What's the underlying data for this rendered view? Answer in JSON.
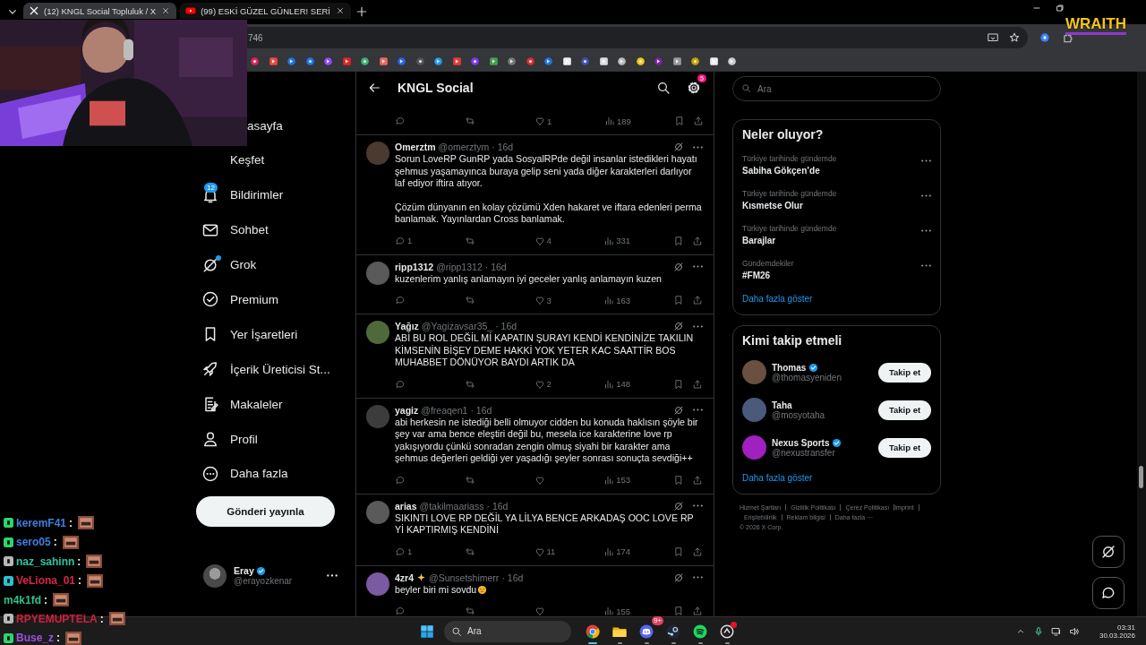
{
  "browser": {
    "tabs": [
      {
        "title": "(12) KNGL Social Topluluk / X",
        "kind": "x",
        "selected": true
      },
      {
        "title": "(99) ESKİ GÜZEL GÜNLER! SERİ",
        "kind": "youtube",
        "selected": false
      }
    ],
    "address": "746"
  },
  "stream_overlay": {
    "logo": "WRAITH",
    "chat": [
      {
        "user": "keremF41",
        "colon": ":",
        "color": "#3f7fe0",
        "badge": {
          "color": "#2fd46a"
        }
      },
      {
        "user": "sero05",
        "colon": ":",
        "color": "#3f7fe0",
        "badge": {
          "color": "#2fd46a"
        }
      },
      {
        "user": "naz_sahinn",
        "colon": ":",
        "color": "#2ec4a0",
        "badge": {
          "color": "#b8b8b8"
        }
      },
      {
        "user": "VeLiona_01",
        "colon": ":",
        "color": "#d8264a",
        "badge": {
          "color": "#30c0d0"
        }
      },
      {
        "user": "m4k1fd",
        "colon": ":",
        "color": "#2ec48a"
      },
      {
        "user": "RPYEMUPTELA",
        "colon": ":",
        "color": "#d0203c",
        "badge": {
          "color": "#b8b8b8"
        }
      },
      {
        "user": "Buse_z",
        "colon": ":",
        "color": "#a050e0",
        "badge": {
          "color": "#2fd46a"
        }
      }
    ]
  },
  "sidebar": {
    "items": [
      {
        "label": "asayfa",
        "kind": "covered",
        "new": false
      },
      {
        "label": "Keşfet",
        "kind": "explore",
        "new": false
      },
      {
        "label": "Bildirimler",
        "kind": "bell",
        "badge": "12",
        "new": false
      },
      {
        "label": "Sohbet",
        "kind": "mail",
        "new": false
      },
      {
        "label": "Grok",
        "kind": "grok",
        "new": true
      },
      {
        "label": "Premium",
        "kind": "premium",
        "new": false
      },
      {
        "label": "Yer İşaretleri",
        "kind": "bookmark",
        "new": false
      },
      {
        "label": "İçerik Üreticisi St...",
        "kind": "rocket",
        "new": false
      },
      {
        "label": "Makaleler",
        "kind": "article",
        "new": false
      },
      {
        "label": "Profil",
        "kind": "profile",
        "new": false
      },
      {
        "label": "Daha fazla",
        "kind": "more",
        "new": false
      }
    ],
    "post_button": "Gönderi yayınla",
    "account": {
      "name": "Eray",
      "verified": true,
      "handle": "@erayozkenar"
    }
  },
  "feed": {
    "title": "KNGL Social",
    "settings_badge": "5",
    "top_actions": {
      "likes": "1",
      "views": "189"
    },
    "posts": [
      {
        "name": "Omerztm",
        "handle": "@omerztym",
        "time": "· 16d",
        "sparkle": false,
        "text": [
          "Sorun LoveRP GunRP yada SosyalRPde değil insanlar istedikleri hayatı şehmus yaşamayınca buraya gelip seni yada diğer karakterleri darlıyor laf ediyor iftira atıyor.",
          "Çözüm dünyanın en kolay çözümü Xden hakaret ve iftara edenleri perma banlamak. Yayınlardan Cross banlamak."
        ],
        "sad_emoji": false,
        "replies": "1",
        "likes": "4",
        "views": "331"
      },
      {
        "name": "ripp1312",
        "handle": "@ripp1312",
        "time": "· 16d",
        "sparkle": false,
        "text": [
          "kuzenlerim yanlış anlamayın iyi geceler yanlış anlamayın kuzen"
        ],
        "sad_emoji": false,
        "likes": "3",
        "views": "163"
      },
      {
        "name": "Yağız",
        "handle": "@Yagizavsar35_",
        "time": "· 16d",
        "sparkle": false,
        "text": [
          "ABİ BU ROL DEĞİL Mİ KAPATIN ŞURAYI KENDİ KENDİNİZE TAKILIN KİMSENİN BİŞEY DEME HAKKİ YOK YETER KAC SAATTİR BOS MUHABBET DÖNÜYOR BAYDI ARTIK DA"
        ],
        "sad_emoji": false,
        "likes": "2",
        "views": "148"
      },
      {
        "name": "yagiz",
        "handle": "@freaqen1",
        "time": "· 16d",
        "sparkle": false,
        "text": [
          "abi herkesin ne istediği belli olmuyor cidden bu konuda haklısın şöyle bir şey var ama bence eleştiri değil bu, mesela ice karakterine love rp yakışıyordu çünkü sonradan zengin olmuş siyahi bir karakter ama şehmus değerleri geldiği yer yaşadığı şeyler sonrası sonuçta sevdiği++"
        ],
        "sad_emoji": false,
        "views": "153"
      },
      {
        "name": "arias",
        "handle": "@takilmaariass",
        "time": "· 16d",
        "sparkle": false,
        "text": [
          "SIKINTI LOVE RP DEĞİL YA LİLYA BENCE ARKADAŞ OOC LOVE RP  Yİ KAPTIRMIŞ KENDİNİ"
        ],
        "sad_emoji": false,
        "replies": "1",
        "likes": "11",
        "views": "174"
      },
      {
        "name": "4zr4",
        "handle": "@Sunsetshimerr",
        "time": "· 16d",
        "sparkle": true,
        "text": [
          "beyler biri mi sovdu"
        ],
        "sad_emoji": true,
        "views": "155"
      }
    ]
  },
  "right": {
    "search": {
      "placeholder": "Ara"
    },
    "trends": {
      "title": "Neler oluyor?",
      "items": [
        {
          "context": "Türkiye tarihinde gündemde",
          "topic": "Sabiha Gökçen’de"
        },
        {
          "context": "Türkiye tarihinde gündemde",
          "topic": "Kısmetse Olur"
        },
        {
          "context": "Türkiye tarihinde gündemde",
          "topic": "Barajlar"
        },
        {
          "context": "Gündemdekiler",
          "topic": "#FM26"
        }
      ],
      "more": "Daha fazla göster"
    },
    "who_to_follow": {
      "title": "Kimi takip etmeli",
      "accounts": [
        {
          "name": "Thomas",
          "verified": true,
          "handle": "@thomasyeniden",
          "button": "Takip et"
        },
        {
          "name": "Taha",
          "verified": false,
          "handle": "@mosyotaha",
          "button": "Takip et"
        },
        {
          "name": "Nexus Sports",
          "verified": true,
          "handle": "@nexustransfer",
          "button": "Takip et"
        }
      ],
      "more": "Daha fazla göster"
    },
    "footer": {
      "links": [
        "Hizmet Şartları",
        "Gizlilik Politikası",
        "Çerez Politikası",
        "Imprint",
        "Erişilebilirlik",
        "Reklam bilgisi",
        "Daha fazla ···"
      ],
      "copyright": "© 2026 X Corp."
    }
  },
  "taskbar": {
    "search_placeholder": "Ara",
    "apps": [
      {
        "kind": "chrome",
        "selected": true
      },
      {
        "kind": "files",
        "selected": false
      },
      {
        "kind": "discord",
        "selected": false,
        "badge": "9+"
      },
      {
        "kind": "steam",
        "selected": false
      },
      {
        "kind": "spotify",
        "selected": false
      },
      {
        "kind": "other",
        "selected": false,
        "alert": true
      }
    ],
    "time": "03:31",
    "date": "30.03.2026"
  }
}
